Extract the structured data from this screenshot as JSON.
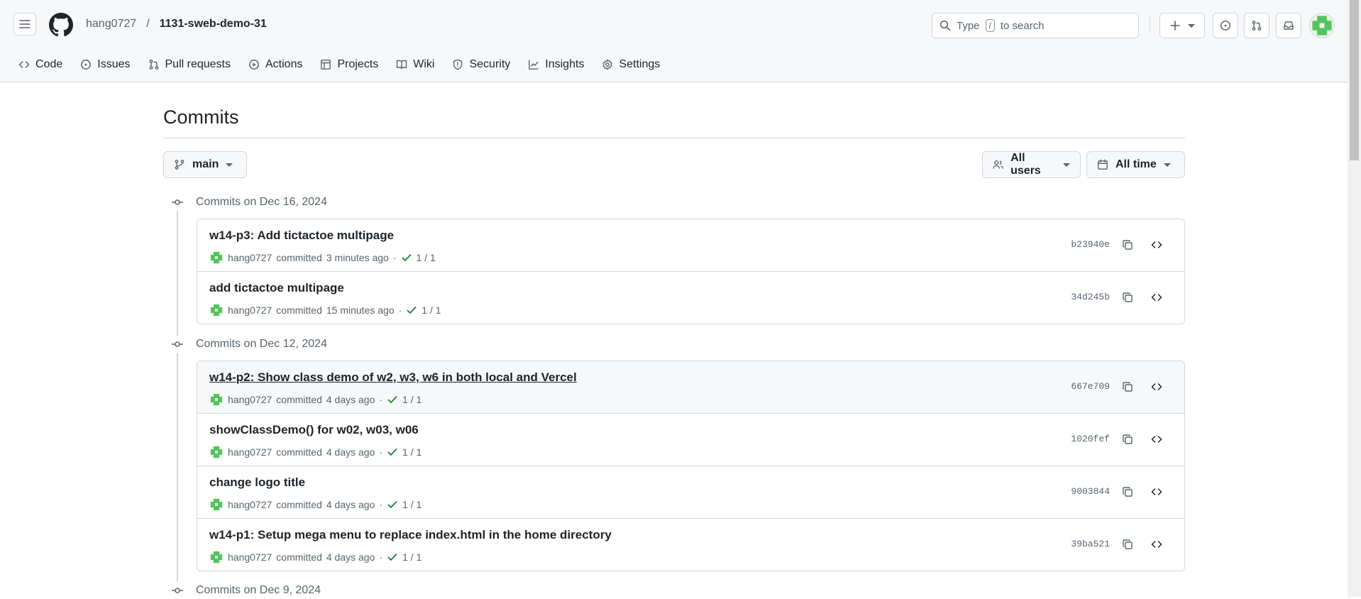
{
  "header": {
    "owner": "hang0727",
    "separator": "/",
    "repo": "1131-sweb-demo-31",
    "search_prefix": "Type",
    "search_key": "/",
    "search_suffix": "to search"
  },
  "nav": [
    {
      "label": "Code",
      "icon": "code-icon"
    },
    {
      "label": "Issues",
      "icon": "issue-icon"
    },
    {
      "label": "Pull requests",
      "icon": "pull-request-icon"
    },
    {
      "label": "Actions",
      "icon": "play-icon"
    },
    {
      "label": "Projects",
      "icon": "table-icon"
    },
    {
      "label": "Wiki",
      "icon": "book-icon"
    },
    {
      "label": "Security",
      "icon": "shield-icon"
    },
    {
      "label": "Insights",
      "icon": "graph-icon"
    },
    {
      "label": "Settings",
      "icon": "gear-icon"
    }
  ],
  "page": {
    "title": "Commits",
    "branch": "main",
    "users_filter": "All users",
    "time_filter": "All time"
  },
  "groups": [
    {
      "heading": "Commits on Dec 16, 2024",
      "commits": [
        {
          "message": "w14-p3: Add tictactoe multipage",
          "author": "hang0727",
          "action": "committed",
          "time": "3 minutes ago",
          "dot": "·",
          "checks": "1 / 1",
          "sha": "b23940e"
        },
        {
          "message": "add tictactoe multipage",
          "author": "hang0727",
          "action": "committed",
          "time": "15 minutes ago",
          "dot": "·",
          "checks": "1 / 1",
          "sha": "34d245b"
        }
      ]
    },
    {
      "heading": "Commits on Dec 12, 2024",
      "commits": [
        {
          "message": "w14-p2: Show class demo of w2, w3, w6 in both local and Vercel",
          "author": "hang0727",
          "action": "committed",
          "time": "4 days ago",
          "dot": "·",
          "checks": "1 / 1",
          "sha": "667e709"
        },
        {
          "message": "showClassDemo() for w02, w03, w06",
          "author": "hang0727",
          "action": "committed",
          "time": "4 days ago",
          "dot": "·",
          "checks": "1 / 1",
          "sha": "1020fef"
        },
        {
          "message": "change logo title",
          "author": "hang0727",
          "action": "committed",
          "time": "4 days ago",
          "dot": "·",
          "checks": "1 / 1",
          "sha": "9003844"
        },
        {
          "message": "w14-p1: Setup mega menu to replace index.html in the home directory",
          "author": "hang0727",
          "action": "committed",
          "time": "4 days ago",
          "dot": "·",
          "checks": "1 / 1",
          "sha": "39ba521"
        }
      ]
    },
    {
      "heading": "Commits on Dec 9, 2024",
      "commits": []
    }
  ],
  "colors": {
    "success": "#1a7f37",
    "muted": "#59636e",
    "border": "#d0d7de"
  }
}
